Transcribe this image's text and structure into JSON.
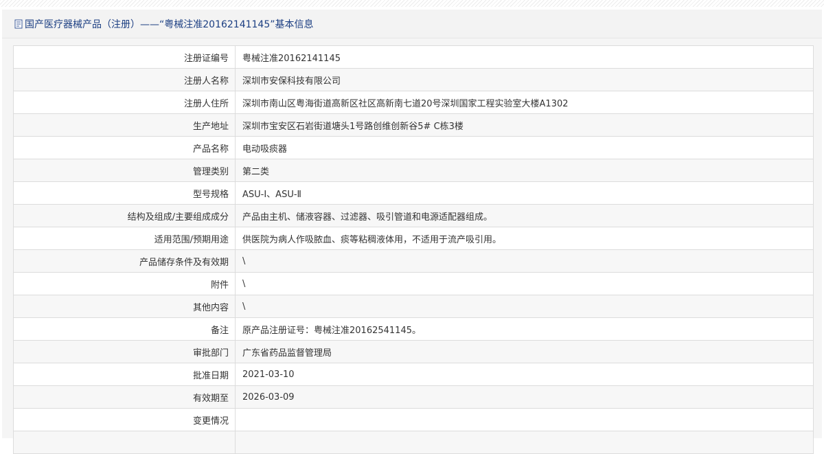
{
  "header": {
    "title": "国产医疗器械产品（注册）——“粤械注准20162141145”基本信息"
  },
  "rows": [
    {
      "label": "注册证编号",
      "value": "粤械注准20162141145"
    },
    {
      "label": "注册人名称",
      "value": "深圳市安保科技有限公司"
    },
    {
      "label": "注册人住所",
      "value": "深圳市南山区粤海街道高新区社区高新南七道20号深圳国家工程实验室大楼A1302"
    },
    {
      "label": "生产地址",
      "value": "深圳市宝安区石岩街道塘头1号路创维创新谷5# C栋3楼"
    },
    {
      "label": "产品名称",
      "value": "电动吸痰器"
    },
    {
      "label": "管理类别",
      "value": "第二类"
    },
    {
      "label": "型号规格",
      "value": "ASU-Ⅰ、ASU-Ⅱ"
    },
    {
      "label": "结构及组成/主要组成成分",
      "value": "产品由主机、储液容器、过滤器、吸引管道和电源适配器组成。"
    },
    {
      "label": "适用范围/预期用途",
      "value": "供医院为病人作吸脓血、痰等粘稠液体用，不适用于流产吸引用。"
    },
    {
      "label": "产品储存条件及有效期",
      "value": "\\"
    },
    {
      "label": "附件",
      "value": "\\"
    },
    {
      "label": "其他内容",
      "value": "\\"
    },
    {
      "label": "备注",
      "value": "原产品注册证号：粤械注准20162541145。"
    },
    {
      "label": "审批部门",
      "value": "广东省药品监督管理局"
    },
    {
      "label": "批准日期",
      "value": "2021-03-10"
    },
    {
      "label": "有效期至",
      "value": "2026-03-09"
    },
    {
      "label": "变更情况",
      "value": ""
    },
    {
      "label": "",
      "value": ""
    }
  ]
}
